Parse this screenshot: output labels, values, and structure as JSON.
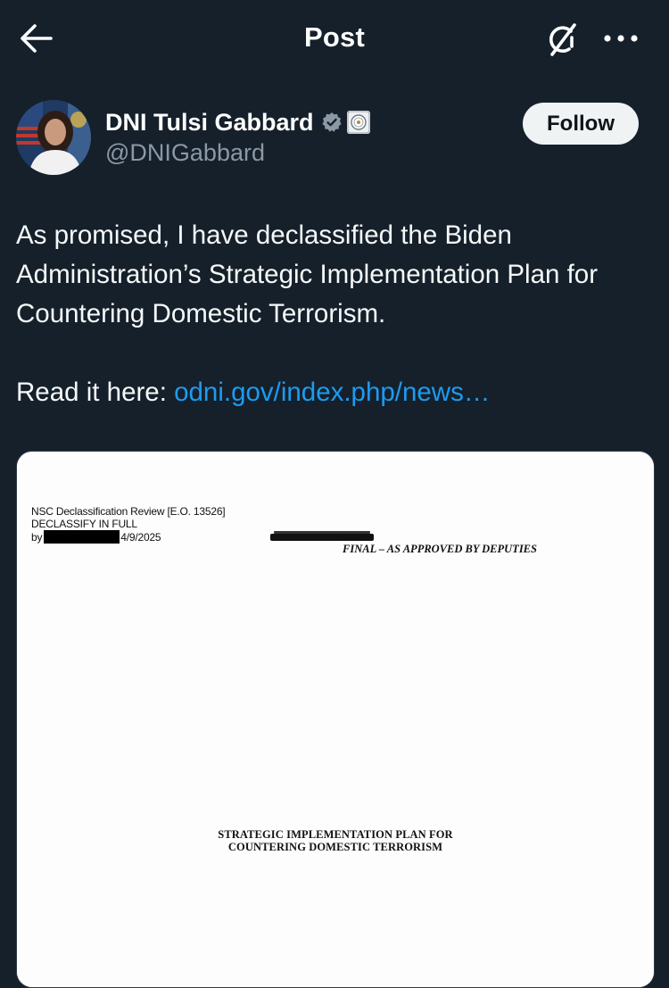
{
  "header": {
    "title": "Post",
    "back_icon": "back-arrow-icon",
    "grok_icon": "grok-icon",
    "more_icon": "more-icon"
  },
  "author": {
    "display_name": "DNI Tulsi Gabbard",
    "handle": "@DNIGabbard",
    "verified_icon": "verified-gray-badge-icon",
    "affiliation_icon": "odni-seal-icon",
    "verified_color": "#8b98a5"
  },
  "follow_button": {
    "label": "Follow"
  },
  "post": {
    "text_line1": "As promised, I have declassified the Biden Administration’s Strategic Implementation Plan for Countering Domestic Terrorism.",
    "read_prefix": "Read it here: ",
    "link_text": "odni.gov/index.php/news…"
  },
  "media": {
    "stamp_line1": "NSC Declassification Review [E.O. 13526]",
    "stamp_line2": "DECLASSIFY IN FULL",
    "stamp_by": "by",
    "stamp_date": "4/9/2025",
    "final_label": "FINAL – AS APPROVED BY DEPUTIES",
    "title_line1": "STRATEGIC IMPLEMENTATION PLAN FOR",
    "title_line2": "COUNTERING DOMESTIC TERRORISM"
  },
  "colors": {
    "background": "#15202b",
    "link": "#1d9bf0",
    "secondary_text": "#8b98a5",
    "follow_bg": "#eff3f4"
  }
}
